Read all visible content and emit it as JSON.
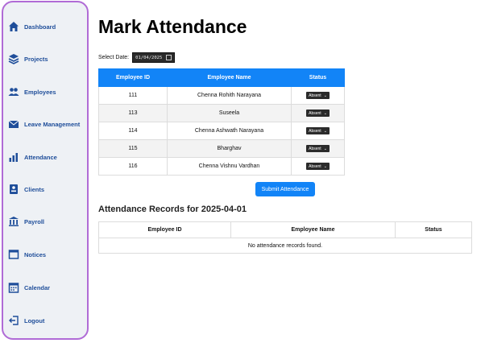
{
  "sidebar": {
    "items": [
      {
        "label": "Dashboard",
        "icon": "home-icon"
      },
      {
        "label": "Projects",
        "icon": "layers-icon"
      },
      {
        "label": "Employees",
        "icon": "users-icon"
      },
      {
        "label": "Leave Management",
        "icon": "mail-icon"
      },
      {
        "label": "Attendance",
        "icon": "bar-chart-icon"
      },
      {
        "label": "Clients",
        "icon": "id-card-icon"
      },
      {
        "label": "Payroll",
        "icon": "bank-icon"
      },
      {
        "label": "Notices",
        "icon": "window-icon"
      },
      {
        "label": "Calendar",
        "icon": "calendar-icon"
      },
      {
        "label": "Logout",
        "icon": "logout-icon"
      }
    ],
    "accent": "#1f4e9a",
    "border_color": "#b06bd6"
  },
  "main": {
    "title": "Mark Attendance",
    "date_label": "Select Date:",
    "date_value": "01/04/2025",
    "columns": [
      "Employee ID",
      "Employee Name",
      "Status"
    ],
    "rows": [
      {
        "id": "111",
        "name": "Chenna Rohith Narayana",
        "status": "Absent"
      },
      {
        "id": "113",
        "name": "Suseela",
        "status": "Absent"
      },
      {
        "id": "114",
        "name": "Chenna Ashwath Narayana",
        "status": "Absent"
      },
      {
        "id": "115",
        "name": "Bharghav",
        "status": "Absent"
      },
      {
        "id": "116",
        "name": "Chenna Vishnu Vardhan",
        "status": "Absent"
      }
    ],
    "submit_label": "Submit Attendance",
    "header_color": "#1284f7"
  },
  "records": {
    "title": "Attendance Records for 2025-04-01",
    "columns": [
      "Employee ID",
      "Employee Name",
      "Status"
    ],
    "empty_message": "No attendance records found."
  }
}
